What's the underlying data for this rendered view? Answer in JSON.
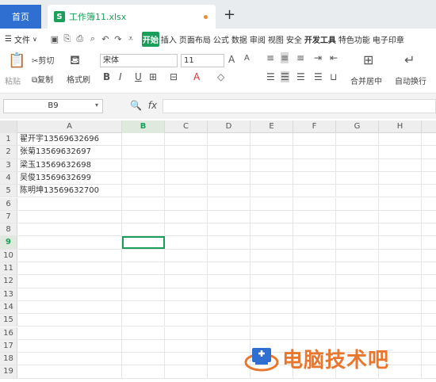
{
  "tabbar": {
    "home_label": "首页",
    "file_name": "工作簿11.xlsx",
    "file_icon": "S",
    "new_tab": "+"
  },
  "menu": {
    "file_label": "文件",
    "tabs": [
      "开始",
      "插入",
      "页面布局",
      "公式",
      "数据",
      "审阅",
      "视图",
      "安全",
      "开发工具",
      "特色功能",
      "电子印章"
    ],
    "active_tab": "开始"
  },
  "ribbon": {
    "paste": "粘贴",
    "cut": "剪切",
    "copy": "复制",
    "format_painter": "格式刷",
    "font_name": "宋体",
    "font_size": "11",
    "merge_center": "合并居中",
    "auto_wrap": "自动换行"
  },
  "formula_bar": {
    "name_box": "B9",
    "fx": "fx",
    "formula": ""
  },
  "columns": [
    "A",
    "B",
    "C",
    "D",
    "E",
    "F",
    "G",
    "H"
  ],
  "active_column": "B",
  "rows": [
    "1",
    "2",
    "3",
    "4",
    "5",
    "6",
    "7",
    "8",
    "9",
    "10",
    "11",
    "12",
    "13",
    "14",
    "15",
    "16",
    "17",
    "18",
    "19"
  ],
  "active_row": "9",
  "cells": {
    "A1": "翟开宇13569632696",
    "A2": "张菊13569632697",
    "A3": "梁玉13569632698",
    "A4": "吴俊13569632699",
    "A5": "陈明坤13569632700"
  },
  "watermark": {
    "text": "电脑技术吧"
  },
  "colors": {
    "accent": "#1a9f5a",
    "home_tab": "#2f6fd1",
    "watermark": "#e8762d"
  }
}
